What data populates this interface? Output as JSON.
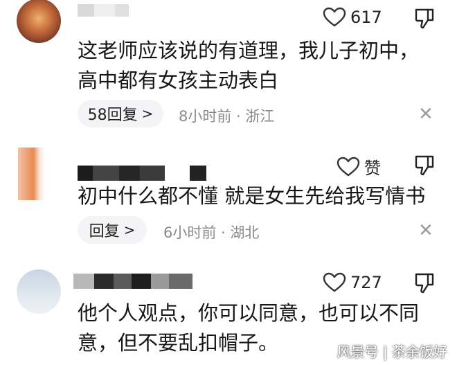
{
  "comments": [
    {
      "like_count": "617",
      "text_lines": [
        "这老师应该说的有道理，我儿子初中，",
        "高中都有女孩主动表白"
      ],
      "reply_label": "58回复",
      "meta": "8小时前 · 浙江"
    },
    {
      "like_count": "赞",
      "text_lines": [
        "初中什么都不懂 就是女生先给我写情书"
      ],
      "reply_label": "回复",
      "meta": "6小时前 · 湖北"
    },
    {
      "like_count": "727",
      "text_lines": [
        "他个人观点，你可以同意，也可以不同",
        "意，但不要乱扣帽子。"
      ]
    }
  ],
  "icons": {
    "like": "heart-icon",
    "dislike": "thumbs-down-icon",
    "close": "close-icon",
    "reply_chevron": "chevron-right-icon"
  },
  "close_glyph": "✕",
  "chevron_glyph": ">",
  "watermark": "风景号 | 茶余饭好"
}
